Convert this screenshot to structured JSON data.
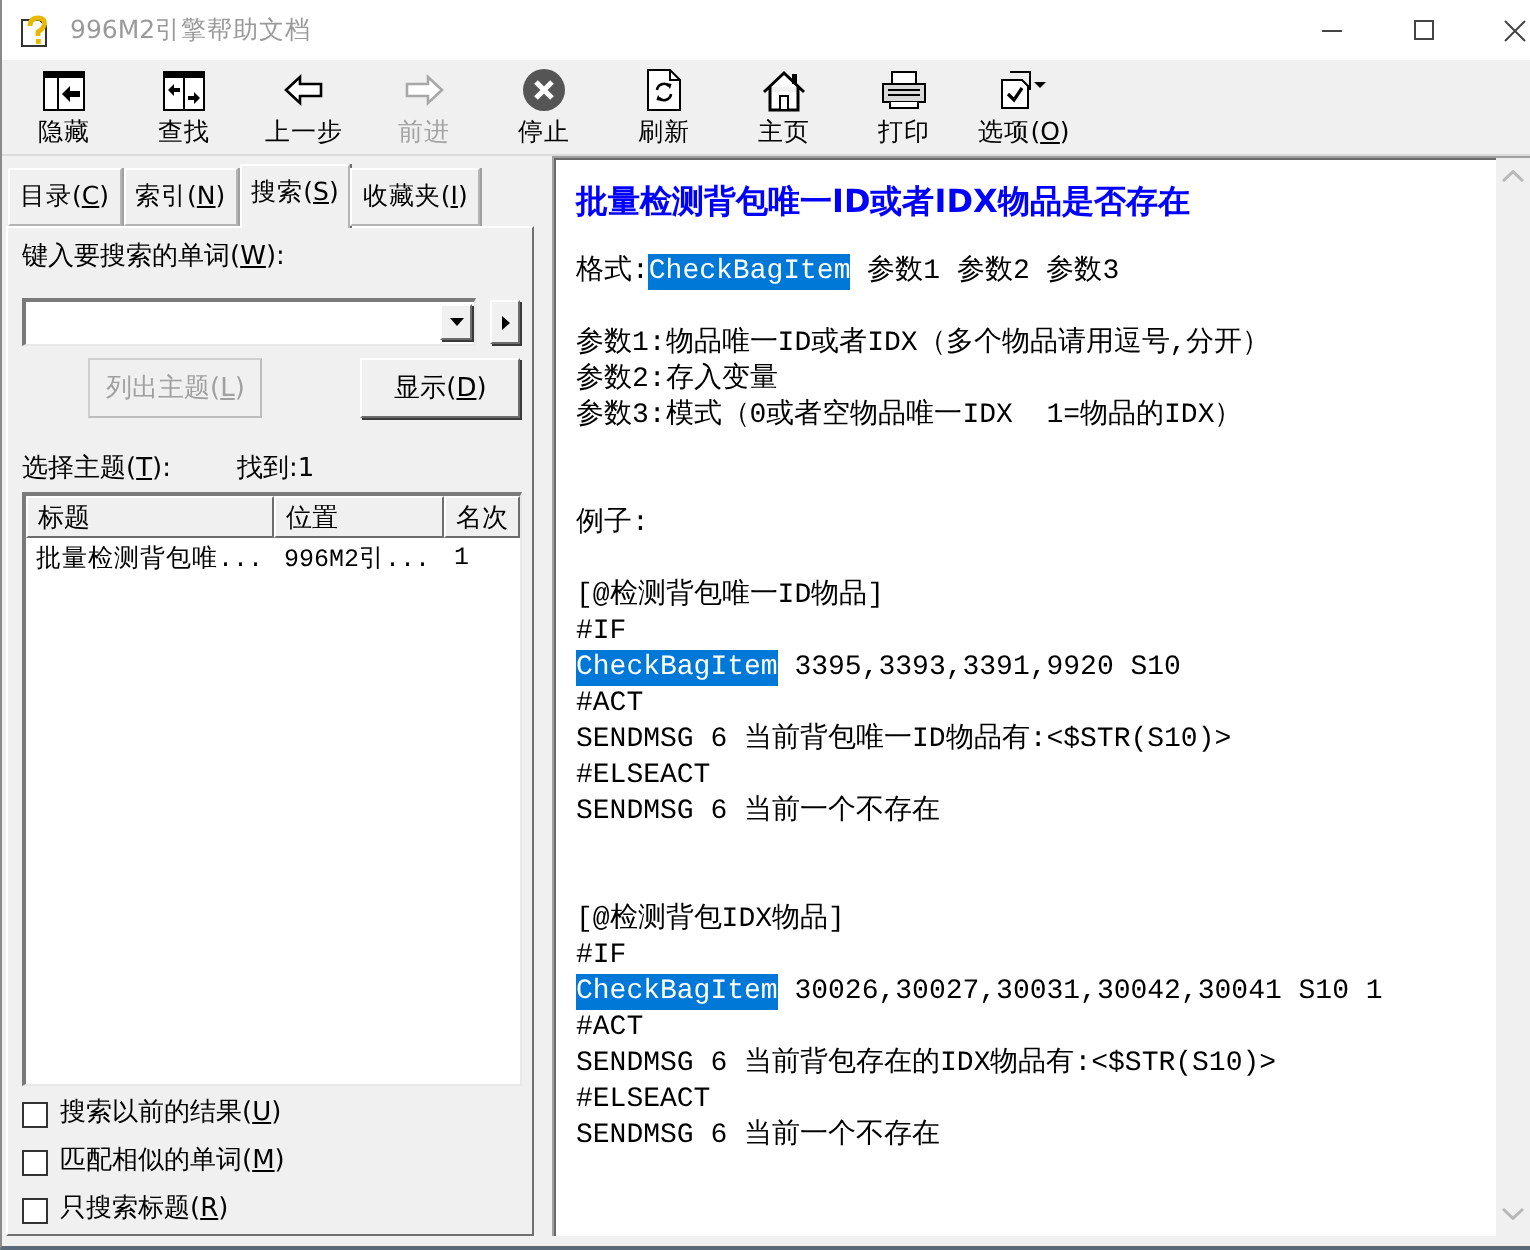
{
  "window": {
    "title": "996M2引擎帮助文档"
  },
  "toolbar": [
    {
      "label": "隐藏",
      "disabled": false
    },
    {
      "label": "查找",
      "disabled": false
    },
    {
      "label": "上一步",
      "disabled": false
    },
    {
      "label": "前进",
      "disabled": true
    },
    {
      "label": "停止",
      "disabled": false
    },
    {
      "label": "刷新",
      "disabled": false
    },
    {
      "label": "主页",
      "disabled": false
    },
    {
      "label": "打印",
      "disabled": false
    },
    {
      "label": "选项(",
      "mnemonic": "O",
      "label_end": ")",
      "disabled": false
    }
  ],
  "navigation_pane": {
    "tabs": [
      {
        "label": "目录(",
        "mnemonic": "C",
        "label_end": ")",
        "selected": false
      },
      {
        "label": "索引(",
        "mnemonic": "N",
        "label_end": ")",
        "selected": false
      },
      {
        "label": "搜索(",
        "mnemonic": "S",
        "label_end": ")",
        "selected": true
      },
      {
        "label": "收藏夹(",
        "mnemonic": "I",
        "label_end": ")",
        "selected": false
      }
    ],
    "search_prompt": {
      "label": "键入要搜索的单词(",
      "mnemonic": "W",
      "label_end": "):"
    },
    "buttons": [
      {
        "label": "列出主题(",
        "mnemonic": "L",
        "label_end": ")",
        "disabled": true
      },
      {
        "label": "显示(",
        "mnemonic": "D",
        "label_end": ")",
        "disabled": false
      }
    ],
    "topics_label": {
      "label": "选择主题(",
      "mnemonic": "T",
      "label_end": "):"
    },
    "found": "找到:1",
    "results": {
      "columns": [
        "标题",
        "位置",
        "名次"
      ],
      "rows": [
        {
          "cells": [
            "批量检测背包唯...",
            "996M2引...",
            "1"
          ]
        }
      ]
    },
    "options": [
      {
        "label": "搜索以前的结果(",
        "mnemonic": "U",
        "label_end": ")",
        "checked": false
      },
      {
        "label": "匹配相似的单词(",
        "mnemonic": "M",
        "label_end": ")",
        "checked": false
      },
      {
        "label": "只搜索标题(",
        "mnemonic": "R",
        "label_end": ")",
        "checked": false
      }
    ]
  },
  "topic": {
    "heading": "批量检测背包唯一ID或者IDX物品是否存在",
    "sections": [
      {
        "lines": [
          {
            "parts": [
              {
                "text": "格式:",
                "highlighted": false
              },
              {
                "text": "CheckBagItem",
                "highlighted": true
              },
              {
                "text": " 参数1 参数2 参数3",
                "highlighted": false
              }
            ]
          }
        ]
      },
      {
        "lines": [
          {
            "parts": [
              {
                "text": "参数1:物品唯一ID或者IDX（多个物品请用逗号,分开）",
                "highlighted": false
              }
            ]
          },
          {
            "parts": [
              {
                "text": "参数2:存入变量",
                "highlighted": false
              }
            ]
          },
          {
            "parts": [
              {
                "text": "参数3:模式（0或者空物品唯一IDX  1=物品的IDX）",
                "highlighted": false
              }
            ]
          }
        ]
      },
      {
        "lines": [
          {
            "parts": [
              {
                "text": "例子:",
                "highlighted": false
              }
            ]
          }
        ]
      },
      {
        "lines": [
          {
            "parts": [
              {
                "text": "[@检测背包唯一ID物品]",
                "highlighted": false
              }
            ]
          },
          {
            "parts": [
              {
                "text": "#IF",
                "highlighted": false
              }
            ]
          },
          {
            "parts": [
              {
                "text": "CheckBagItem",
                "highlighted": true
              },
              {
                "text": " 3395,3393,3391,9920 S10",
                "highlighted": false
              }
            ]
          },
          {
            "parts": [
              {
                "text": "#ACT",
                "highlighted": false
              }
            ]
          },
          {
            "parts": [
              {
                "text": "SENDMSG 6 当前背包唯一ID物品有:<$STR(S10)>",
                "highlighted": false
              }
            ]
          },
          {
            "parts": [
              {
                "text": "#ELSEACT",
                "highlighted": false
              }
            ]
          },
          {
            "parts": [
              {
                "text": "SENDMSG 6 当前一个不存在",
                "highlighted": false
              }
            ]
          }
        ]
      },
      {
        "lines": [
          {
            "parts": [
              {
                "text": "[@检测背包IDX物品]",
                "highlighted": false
              }
            ]
          },
          {
            "parts": [
              {
                "text": "#IF",
                "highlighted": false
              }
            ]
          },
          {
            "parts": [
              {
                "text": "CheckBagItem",
                "highlighted": true
              },
              {
                "text": " 30026,30027,30031,30042,30041 S10 1",
                "highlighted": false
              }
            ]
          },
          {
            "parts": [
              {
                "text": "#ACT",
                "highlighted": false
              }
            ]
          },
          {
            "parts": [
              {
                "text": "SENDMSG 6 当前背包存在的IDX物品有:<$STR(S10)>",
                "highlighted": false
              }
            ]
          },
          {
            "parts": [
              {
                "text": "#ELSEACT",
                "highlighted": false
              }
            ]
          },
          {
            "parts": [
              {
                "text": "SENDMSG 6 当前一个不存在",
                "highlighted": false
              }
            ]
          }
        ]
      }
    ]
  }
}
